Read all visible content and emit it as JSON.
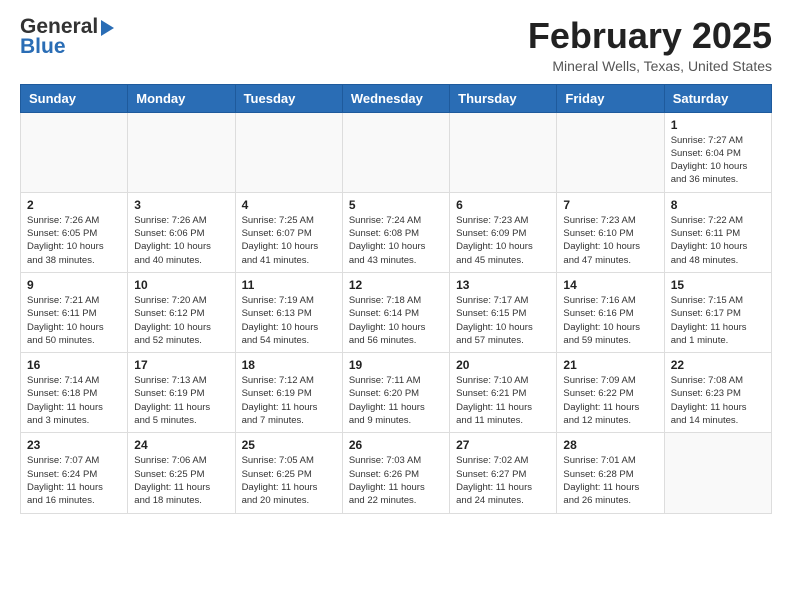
{
  "header": {
    "logo_general": "General",
    "logo_blue": "Blue",
    "title": "February 2025",
    "location": "Mineral Wells, Texas, United States"
  },
  "weekdays": [
    "Sunday",
    "Monday",
    "Tuesday",
    "Wednesday",
    "Thursday",
    "Friday",
    "Saturday"
  ],
  "weeks": [
    [
      {
        "day": "",
        "info": ""
      },
      {
        "day": "",
        "info": ""
      },
      {
        "day": "",
        "info": ""
      },
      {
        "day": "",
        "info": ""
      },
      {
        "day": "",
        "info": ""
      },
      {
        "day": "",
        "info": ""
      },
      {
        "day": "1",
        "info": "Sunrise: 7:27 AM\nSunset: 6:04 PM\nDaylight: 10 hours\nand 36 minutes."
      }
    ],
    [
      {
        "day": "2",
        "info": "Sunrise: 7:26 AM\nSunset: 6:05 PM\nDaylight: 10 hours\nand 38 minutes."
      },
      {
        "day": "3",
        "info": "Sunrise: 7:26 AM\nSunset: 6:06 PM\nDaylight: 10 hours\nand 40 minutes."
      },
      {
        "day": "4",
        "info": "Sunrise: 7:25 AM\nSunset: 6:07 PM\nDaylight: 10 hours\nand 41 minutes."
      },
      {
        "day": "5",
        "info": "Sunrise: 7:24 AM\nSunset: 6:08 PM\nDaylight: 10 hours\nand 43 minutes."
      },
      {
        "day": "6",
        "info": "Sunrise: 7:23 AM\nSunset: 6:09 PM\nDaylight: 10 hours\nand 45 minutes."
      },
      {
        "day": "7",
        "info": "Sunrise: 7:23 AM\nSunset: 6:10 PM\nDaylight: 10 hours\nand 47 minutes."
      },
      {
        "day": "8",
        "info": "Sunrise: 7:22 AM\nSunset: 6:11 PM\nDaylight: 10 hours\nand 48 minutes."
      }
    ],
    [
      {
        "day": "9",
        "info": "Sunrise: 7:21 AM\nSunset: 6:11 PM\nDaylight: 10 hours\nand 50 minutes."
      },
      {
        "day": "10",
        "info": "Sunrise: 7:20 AM\nSunset: 6:12 PM\nDaylight: 10 hours\nand 52 minutes."
      },
      {
        "day": "11",
        "info": "Sunrise: 7:19 AM\nSunset: 6:13 PM\nDaylight: 10 hours\nand 54 minutes."
      },
      {
        "day": "12",
        "info": "Sunrise: 7:18 AM\nSunset: 6:14 PM\nDaylight: 10 hours\nand 56 minutes."
      },
      {
        "day": "13",
        "info": "Sunrise: 7:17 AM\nSunset: 6:15 PM\nDaylight: 10 hours\nand 57 minutes."
      },
      {
        "day": "14",
        "info": "Sunrise: 7:16 AM\nSunset: 6:16 PM\nDaylight: 10 hours\nand 59 minutes."
      },
      {
        "day": "15",
        "info": "Sunrise: 7:15 AM\nSunset: 6:17 PM\nDaylight: 11 hours\nand 1 minute."
      }
    ],
    [
      {
        "day": "16",
        "info": "Sunrise: 7:14 AM\nSunset: 6:18 PM\nDaylight: 11 hours\nand 3 minutes."
      },
      {
        "day": "17",
        "info": "Sunrise: 7:13 AM\nSunset: 6:19 PM\nDaylight: 11 hours\nand 5 minutes."
      },
      {
        "day": "18",
        "info": "Sunrise: 7:12 AM\nSunset: 6:19 PM\nDaylight: 11 hours\nand 7 minutes."
      },
      {
        "day": "19",
        "info": "Sunrise: 7:11 AM\nSunset: 6:20 PM\nDaylight: 11 hours\nand 9 minutes."
      },
      {
        "day": "20",
        "info": "Sunrise: 7:10 AM\nSunset: 6:21 PM\nDaylight: 11 hours\nand 11 minutes."
      },
      {
        "day": "21",
        "info": "Sunrise: 7:09 AM\nSunset: 6:22 PM\nDaylight: 11 hours\nand 12 minutes."
      },
      {
        "day": "22",
        "info": "Sunrise: 7:08 AM\nSunset: 6:23 PM\nDaylight: 11 hours\nand 14 minutes."
      }
    ],
    [
      {
        "day": "23",
        "info": "Sunrise: 7:07 AM\nSunset: 6:24 PM\nDaylight: 11 hours\nand 16 minutes."
      },
      {
        "day": "24",
        "info": "Sunrise: 7:06 AM\nSunset: 6:25 PM\nDaylight: 11 hours\nand 18 minutes."
      },
      {
        "day": "25",
        "info": "Sunrise: 7:05 AM\nSunset: 6:25 PM\nDaylight: 11 hours\nand 20 minutes."
      },
      {
        "day": "26",
        "info": "Sunrise: 7:03 AM\nSunset: 6:26 PM\nDaylight: 11 hours\nand 22 minutes."
      },
      {
        "day": "27",
        "info": "Sunrise: 7:02 AM\nSunset: 6:27 PM\nDaylight: 11 hours\nand 24 minutes."
      },
      {
        "day": "28",
        "info": "Sunrise: 7:01 AM\nSunset: 6:28 PM\nDaylight: 11 hours\nand 26 minutes."
      },
      {
        "day": "",
        "info": ""
      }
    ]
  ]
}
